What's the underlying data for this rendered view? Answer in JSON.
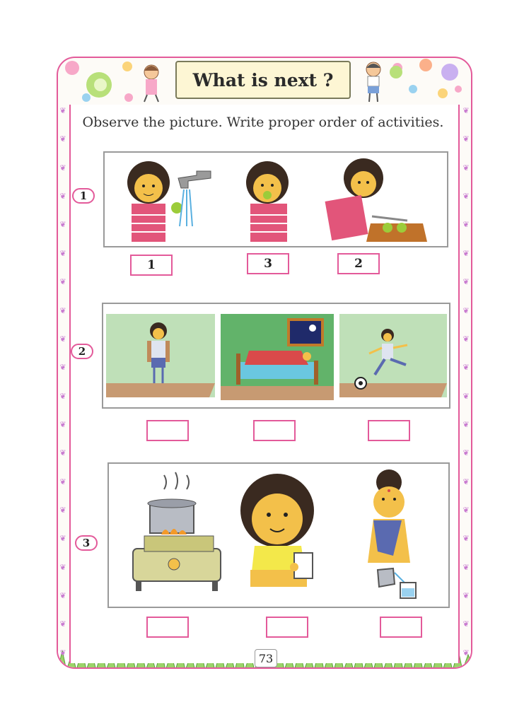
{
  "page": {
    "title": "What is next ?",
    "instruction": "Observe the picture. Write proper order of activities.",
    "page_number": "73"
  },
  "questions": [
    {
      "number": "1",
      "answers": [
        "1",
        "3",
        "2"
      ],
      "scenes": [
        "washing-hands",
        "eating-fruit",
        "cutting-fruit"
      ]
    },
    {
      "number": "2",
      "answers": [
        "",
        "",
        ""
      ],
      "scenes": [
        "child-with-school-bag",
        "sleeping-in-bed-at-night",
        "playing-football"
      ]
    },
    {
      "number": "3",
      "answers": [
        "",
        "",
        ""
      ],
      "scenes": [
        "boiling-on-stove",
        "drinking-from-cup",
        "pouring-tea"
      ]
    }
  ],
  "colors": {
    "frame": "#e35a9a",
    "banner": "#fdf6d4",
    "wall_green": "#bfe0b8",
    "floor": "#c79a72"
  }
}
